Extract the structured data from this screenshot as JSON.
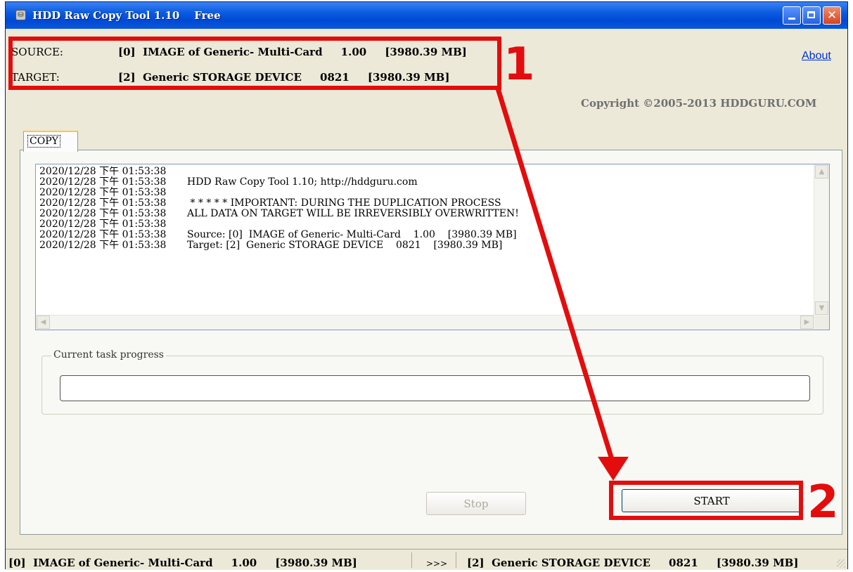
{
  "window": {
    "title": "HDD Raw Copy Tool 1.10    Free"
  },
  "header": {
    "source_label": "SOURCE:",
    "source_value": "[0]  IMAGE of Generic- Multi-Card     1.00     [3980.39 MB]",
    "target_label": "TARGET:",
    "target_value": "[2]  Generic STORAGE DEVICE     0821     [3980.39 MB]",
    "about_link": "About",
    "copyright": "Copyright ©2005-2013 HDDGURU.COM"
  },
  "tabs": [
    {
      "label": "COPY",
      "active": true
    }
  ],
  "log": [
    {
      "time": "2020/12/28 下午 01:53:38",
      "message": ""
    },
    {
      "time": "2020/12/28 下午 01:53:38",
      "message": "HDD Raw Copy Tool 1.10; http://hddguru.com"
    },
    {
      "time": "2020/12/28 下午 01:53:38",
      "message": ""
    },
    {
      "time": "2020/12/28 下午 01:53:38",
      "message": " * * * * * IMPORTANT: DURING THE DUPLICATION PROCESS"
    },
    {
      "time": "2020/12/28 下午 01:53:38",
      "message": "ALL DATA ON TARGET WILL BE IRREVERSIBLY OVERWRITTEN!"
    },
    {
      "time": "2020/12/28 下午 01:53:38",
      "message": ""
    },
    {
      "time": "2020/12/28 下午 01:53:38",
      "message": "Source: [0]  IMAGE of Generic- Multi-Card    1.00    [3980.39 MB]"
    },
    {
      "time": "2020/12/28 下午 01:53:38",
      "message": "Target: [2]  Generic STORAGE DEVICE    0821    [3980.39 MB]"
    }
  ],
  "progress": {
    "label": "Current task progress",
    "value": 0
  },
  "buttons": {
    "stop": "Stop",
    "start": "START"
  },
  "statusbar": {
    "source": "[0]  IMAGE of Generic- Multi-Card     1.00     [3980.39 MB]",
    "arrow": ">>>",
    "target": "[2]  Generic STORAGE DEVICE     0821     [3980.39 MB]"
  },
  "annotations": {
    "step1": "1",
    "step2": "2"
  },
  "colors": {
    "highlight": "#e30d0d",
    "titlebar": "#0a5be0",
    "link": "#0033cc"
  },
  "icons": [
    "app-icon",
    "minimize-icon",
    "maximize-icon",
    "close-icon",
    "scroll-up-icon",
    "scroll-down-icon",
    "scroll-left-icon",
    "scroll-right-icon",
    "resize-grip-icon"
  ]
}
